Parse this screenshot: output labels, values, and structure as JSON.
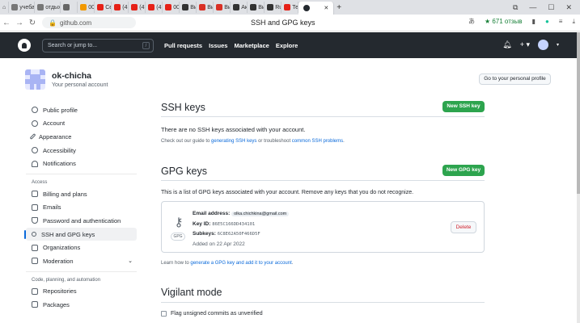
{
  "browser": {
    "tabs": [
      {
        "label": "учеба",
        "color": "#777"
      },
      {
        "label": "отдых",
        "color": "#777"
      },
      {
        "label": "",
        "color": "#666"
      },
      {
        "label": "00",
        "color": "#f29900"
      },
      {
        "label": "Се",
        "color": "#e62117"
      },
      {
        "label": "(4",
        "color": "#e62117"
      },
      {
        "label": "(47",
        "color": "#e62117"
      },
      {
        "label": "(4",
        "color": "#e62117"
      },
      {
        "label": "00",
        "color": "#e62117"
      },
      {
        "label": "Ви",
        "color": "#333"
      },
      {
        "label": "Ви",
        "color": "#d93025"
      },
      {
        "label": "Ви",
        "color": "#d93025"
      },
      {
        "label": "Ак",
        "color": "#333"
      },
      {
        "label": "Ви",
        "color": "#333"
      },
      {
        "label": "Ru",
        "color": "#333"
      },
      {
        "label": "Те",
        "color": "#e62117"
      }
    ],
    "url": "github.com",
    "page_title": "SSH and GPG keys",
    "reviews": "★ 671 отзыв"
  },
  "header": {
    "search_placeholder": "Search or jump to...",
    "nav": [
      "Pull requests",
      "Issues",
      "Marketplace",
      "Explore"
    ]
  },
  "profile": {
    "username": "ok-chicha",
    "subtitle": "Your personal account",
    "go_profile": "Go to your personal profile"
  },
  "sidebar": {
    "top": [
      "Public profile",
      "Account",
      "Appearance",
      "Accessibility",
      "Notifications"
    ],
    "access_header": "Access",
    "access": [
      "Billing and plans",
      "Emails",
      "Password and authentication",
      "SSH and GPG keys",
      "Organizations",
      "Moderation"
    ],
    "code_header": "Code, planning, and automation",
    "code": [
      "Repositories",
      "Packages"
    ]
  },
  "ssh": {
    "title": "SSH keys",
    "button": "New SSH key",
    "empty": "There are no SSH keys associated with your account.",
    "guide_pre": "Check out our guide to ",
    "guide_link": "generating SSH keys",
    "guide_mid": " or troubleshoot ",
    "guide_link2": "common SSH problems",
    "guide_end": "."
  },
  "gpg": {
    "title": "GPG keys",
    "button": "New GPG key",
    "desc": "This is a list of GPG keys associated with your account. Remove any keys that you do not recognize.",
    "badge": "GPG",
    "email_label": "Email address:",
    "email": "olka.chichkina@gmail.com",
    "keyid_label": "Key ID:",
    "keyid": "86E5C166DD434101",
    "subkeys_label": "Subkeys:",
    "subkeys": "6C8E62A50F466D5F",
    "added": "Added on 22 Apr 2022",
    "delete": "Delete",
    "learn_pre": "Learn how to ",
    "learn_link": "generate a GPG key and add it to your account",
    "learn_end": "."
  },
  "vigilant": {
    "title": "Vigilant mode",
    "checkbox": "Flag unsigned commits as unverified"
  }
}
